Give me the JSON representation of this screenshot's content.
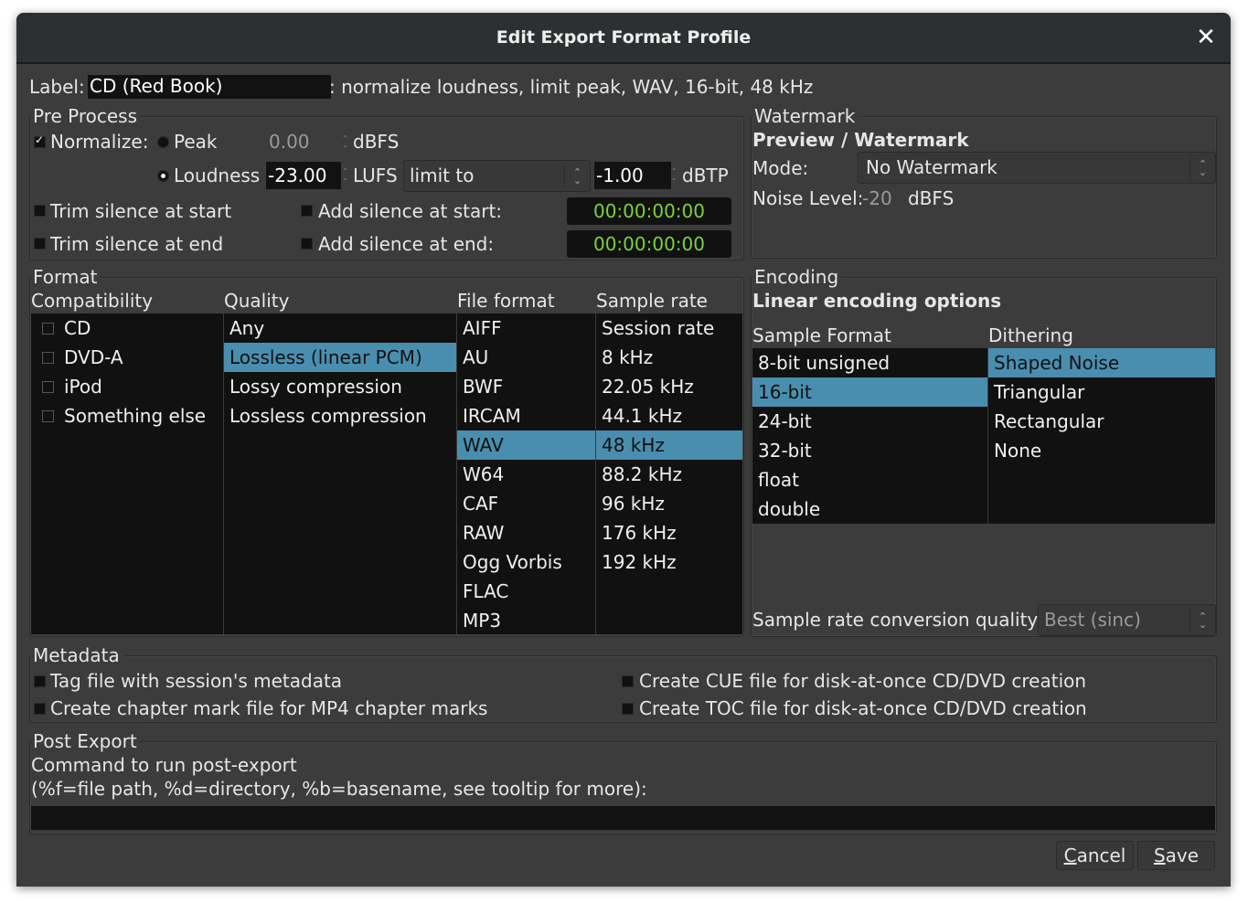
{
  "window": {
    "title": "Edit Export Format Profile",
    "close_icon": "close-icon"
  },
  "label_row": {
    "label": "Label:",
    "value": "CD (Red Book)",
    "summary": ": normalize loudness, limit peak, WAV, 16-bit, 48 kHz"
  },
  "pre_process": {
    "title": "Pre Process",
    "normalize_label": "Normalize:",
    "normalize_checked": true,
    "peak_label": "Peak",
    "peak_value": "0.00",
    "peak_unit": "dBFS",
    "peak_selected": false,
    "loudness_label": "Loudness",
    "loudness_value": "-23.00",
    "loudness_unit": "LUFS",
    "loudness_selected": true,
    "limit_mode": "limit to",
    "limit_value": "-1.00",
    "limit_unit": "dBTP",
    "trim_start_label": "Trim silence at start",
    "trim_end_label": "Trim silence at end",
    "add_start_label": "Add silence at start:",
    "add_end_label": "Add silence at end:",
    "add_start_time": "00:00:00:00",
    "add_end_time": "00:00:00:00"
  },
  "watermark": {
    "title": "Watermark",
    "heading": "Preview / Watermark",
    "mode_label": "Mode:",
    "mode_value": "No Watermark",
    "noise_label": "Noise Level:",
    "noise_value": "-20",
    "noise_unit": "dBFS"
  },
  "format": {
    "title": "Format",
    "columns": {
      "compatibility": "Compatibility",
      "quality": "Quality",
      "file_format": "File format",
      "sample_rate": "Sample rate"
    },
    "compatibility": [
      "CD",
      "DVD-A",
      "iPod",
      "Something else"
    ],
    "quality": [
      "Any",
      "Lossless (linear PCM)",
      "Lossy compression",
      "Lossless compression"
    ],
    "quality_selected": 1,
    "file_formats": [
      "AIFF",
      "AU",
      "BWF",
      "IRCAM",
      "WAV",
      "W64",
      "CAF",
      "RAW",
      "Ogg Vorbis",
      "FLAC",
      "MP3"
    ],
    "file_format_selected": 4,
    "sample_rates": [
      "Session rate",
      "8 kHz",
      "22.05 kHz",
      "44.1 kHz",
      "48 kHz",
      "88.2 kHz",
      "96 kHz",
      "176 kHz",
      "192 kHz"
    ],
    "sample_rate_selected": 4
  },
  "encoding": {
    "title": "Encoding",
    "heading": "Linear encoding options",
    "sample_format_label": "Sample Format",
    "dithering_label": "Dithering",
    "sample_formats": [
      "8-bit unsigned",
      "16-bit",
      "24-bit",
      "32-bit",
      "float",
      "double"
    ],
    "sample_format_selected": 1,
    "dithering": [
      "Shaped Noise",
      "Triangular",
      "Rectangular",
      "None"
    ],
    "dithering_selected": 0,
    "src_label": "Sample rate conversion quality:",
    "src_value": "Best (sinc)"
  },
  "metadata": {
    "title": "Metadata",
    "tag_label": "Tag file with session's metadata",
    "chapter_label": "Create chapter mark file for MP4 chapter marks",
    "cue_label": "Create CUE file for disk-at-once CD/DVD creation",
    "toc_label": "Create TOC file for disk-at-once CD/DVD creation"
  },
  "post_export": {
    "title": "Post Export",
    "line1": "Command to run post-export",
    "line2": "(%f=file path, %d=directory, %b=basename, see tooltip for more):",
    "command_value": ""
  },
  "buttons": {
    "cancel_mnemonic": "C",
    "cancel_rest": "ancel",
    "save_mnemonic": "S",
    "save_rest": "ave"
  }
}
